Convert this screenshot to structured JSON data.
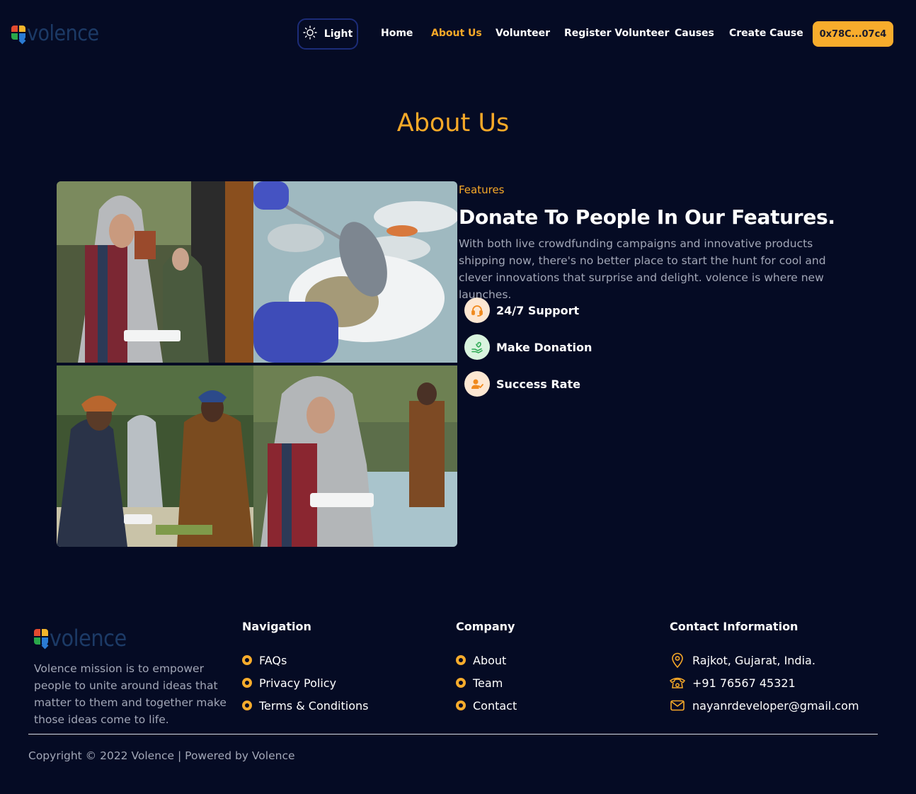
{
  "brand": {
    "logo_text": "volence"
  },
  "header": {
    "theme_toggle_label": "Light",
    "nav": [
      {
        "label": "Home",
        "active": false
      },
      {
        "label": "About Us",
        "active": true
      },
      {
        "label": "Volunteer",
        "active": false
      },
      {
        "label": "Register Volunteer",
        "active": false
      },
      {
        "label": "Causes",
        "active": false
      },
      {
        "label": "Create Cause",
        "active": false
      }
    ],
    "wallet_label": "0x78C...07c4"
  },
  "about": {
    "title": "About Us",
    "kicker": "Features",
    "heading": "Donate To People In Our Features.",
    "text": "With both live crowdfunding campaigns and innovative products shipping now, there's no better place to start the hunt for cool and clever innovations that surprise and delight. volence is where new launches.",
    "features": [
      {
        "label": "24/7 Support",
        "icon": "headset-icon"
      },
      {
        "label": "Make Donation",
        "icon": "donation-hand-icon"
      },
      {
        "label": "Success Rate",
        "icon": "user-check-icon"
      }
    ]
  },
  "footer": {
    "logo_text": "volence",
    "about_text": "Volence mission is to empower people to unite around ideas that matter to them and together make those ideas come to life.",
    "navigation": {
      "title": "Navigation",
      "items": [
        "FAQs",
        "Privacy Policy",
        "Terms & Conditions"
      ]
    },
    "company": {
      "title": "Company",
      "items": [
        "About",
        "Team",
        "Contact"
      ]
    },
    "contact": {
      "title": "Contact Information",
      "address": "Rajkot, Gujarat, India.",
      "phone": "+91 76567 45321",
      "email": "nayanrdeveloper@gmail.com"
    },
    "copyright": "Copyright © 2022 Volence | Powered by Volence"
  },
  "colors": {
    "background": "#050b24",
    "accent": "#f7a928",
    "button": "#f8ac2c",
    "muted_text": "#a2a7b7"
  }
}
